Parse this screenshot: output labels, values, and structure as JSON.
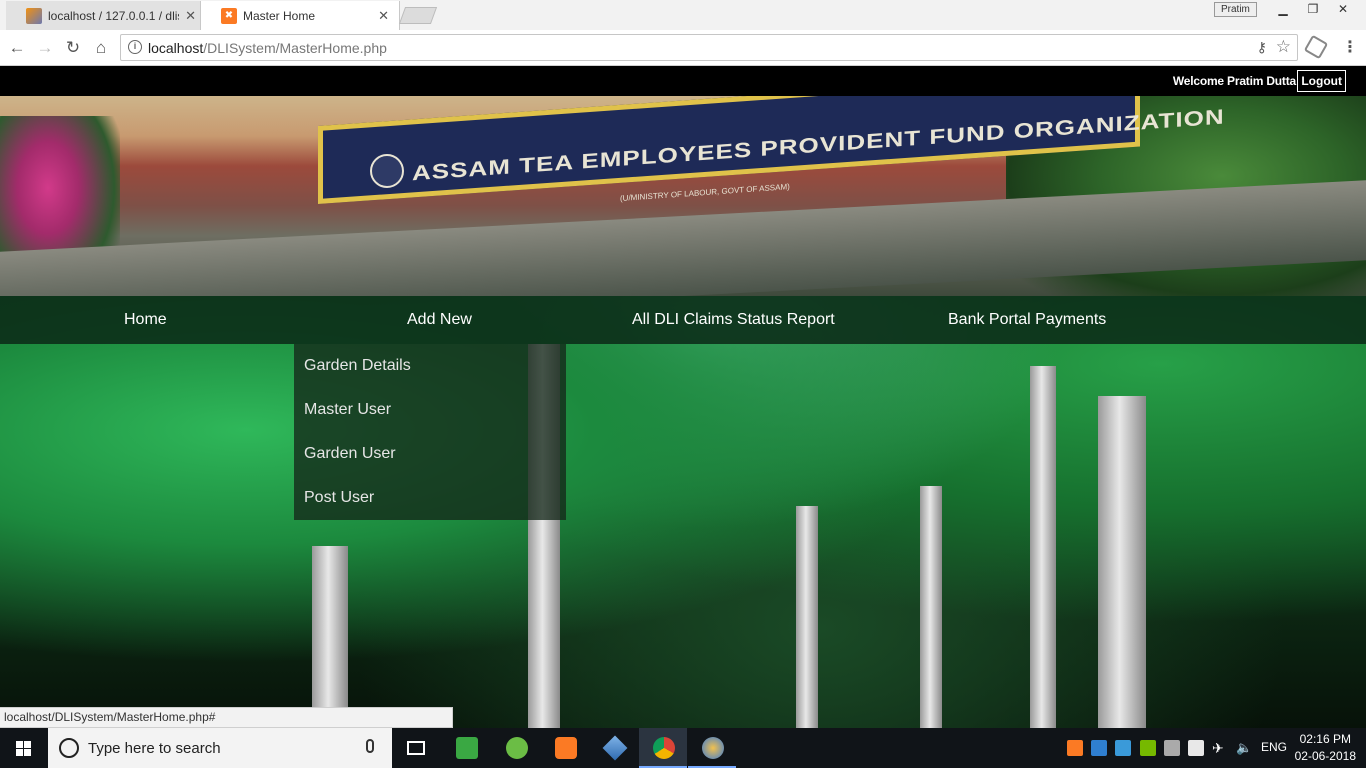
{
  "browser": {
    "tabs": [
      {
        "title": "localhost / 127.0.0.1 / dlis",
        "active": false
      },
      {
        "title": "Master Home",
        "active": true
      }
    ],
    "profile_name": "Pratim",
    "url_host": "localhost",
    "url_path": "/DLISystem/MasterHome.php",
    "status_url": "localhost/DLISystem/MasterHome.php#"
  },
  "header": {
    "welcome_text": "Welcome Pratim Dutta",
    "logout_label": "Logout"
  },
  "banner": {
    "sign_text": "ASSAM TEA EMPLOYEES PROVIDENT FUND ORGANIZATION",
    "sign_subtext": "(U/MINISTRY OF LABOUR, GOVT OF ASSAM)"
  },
  "nav": {
    "items": [
      {
        "label": "Home"
      },
      {
        "label": "Add New"
      },
      {
        "label": "All DLI Claims Status Report"
      },
      {
        "label": "Bank Portal Payments"
      }
    ],
    "add_new_dropdown": [
      {
        "label": "Garden Details"
      },
      {
        "label": "Master User"
      },
      {
        "label": "Garden User"
      },
      {
        "label": "Post User"
      }
    ]
  },
  "taskbar": {
    "search_placeholder": "Type here to search",
    "language": "ENG",
    "time": "02:16 PM",
    "date": "02-06-2018"
  }
}
